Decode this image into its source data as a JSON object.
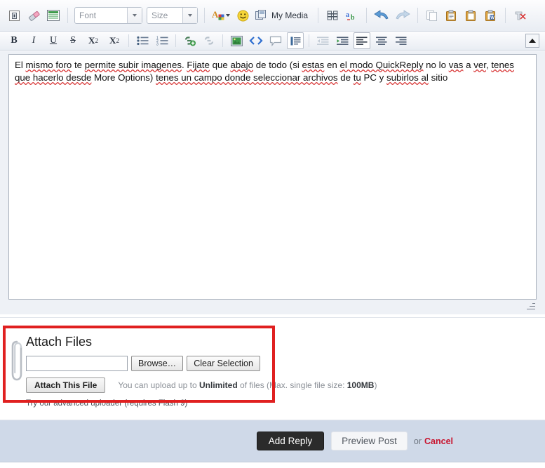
{
  "toolbar_row1": {
    "buttons": [
      {
        "name": "remove-formatting-icon",
        "label": ""
      },
      {
        "name": "eraser-icon",
        "label": ""
      },
      {
        "name": "insert-table-icon",
        "label": ""
      }
    ],
    "font_select": {
      "value": "Font",
      "name": "font-family-select"
    },
    "size_select": {
      "value": "Size",
      "name": "font-size-select"
    },
    "font_color": {
      "name": "font-color-icon"
    },
    "smiley": {
      "name": "smiley-icon"
    },
    "my_media": {
      "label": "My Media",
      "name": "my-media-button"
    },
    "find": {
      "name": "find-icon"
    },
    "spellcheck": {
      "name": "spellcheck-icon"
    },
    "undo": {
      "name": "undo-icon"
    },
    "redo": {
      "name": "redo-icon"
    },
    "copy": {
      "name": "copy-icon"
    },
    "paste": {
      "name": "paste-icon"
    },
    "paste_text": {
      "name": "paste-as-text-icon"
    },
    "paste_word": {
      "name": "paste-from-word-icon"
    },
    "remove_all": {
      "name": "remove-all-formatting-icon"
    }
  },
  "toolbar_row2": {
    "bold": "B",
    "italic": "I",
    "underline": "U",
    "strike": "S",
    "subscript": "X",
    "subscript_sup": "2",
    "superscript": "X",
    "superscript_sup": "2",
    "collapse_label": ""
  },
  "editor": {
    "line1_a": "El ",
    "line1_sp1": "mismo foro",
    "line1_b": " te ",
    "line1_sp2": "permite subir imagenes",
    "line1_c": ". ",
    "line1_sp3": "Fijate",
    "line1_d": " que ",
    "line1_sp4": "abajo",
    "line1_e": " de todo (si ",
    "line1_sp5": "estas",
    "line1_f": " en ",
    "line1_sp6": "el modo QuickReply",
    "line1_g": " no lo ",
    "line1_sp7": "vas",
    "line1_h": " a ",
    "line1_sp8": "ver",
    "line1_i": ",",
    "line2_sp1": "tenes que hacerlo desde",
    "line2_a": " More Options) ",
    "line2_sp2": "tenes un campo donde seleccionar archivos",
    "line2_b": " de ",
    "line2_sp3": "tu",
    "line2_c": " PC y ",
    "line2_sp4": "subirlos al",
    "line2_d": " sitio",
    "full_text": "El mismo foro te permite subir imagenes. Fijate que abajo de todo (si estas en el modo QuickReply no lo vas a ver, tenes que hacerlo desde More Options) tenes un campo donde seleccionar archivos de tu PC y subirlos al sitio"
  },
  "attach": {
    "title": "Attach Files",
    "file_input_value": "",
    "browse_label": "Browse…",
    "clear_label": "Clear Selection",
    "attach_label": "Attach This File",
    "note_prefix": "You can upload up to ",
    "note_limit": "Unlimited",
    "note_middle": " of files (Max. single file size: ",
    "note_size": "100MB",
    "note_suffix": ")",
    "advanced_uploader": "Try our advanced uploader (requires Flash 9)",
    "highlight_color": "#e02020"
  },
  "footer": {
    "add_reply": "Add Reply",
    "preview_post": "Preview Post",
    "or": "or",
    "cancel": "Cancel",
    "background_color": "#cfd9e8",
    "cancel_color": "#c8142e"
  }
}
